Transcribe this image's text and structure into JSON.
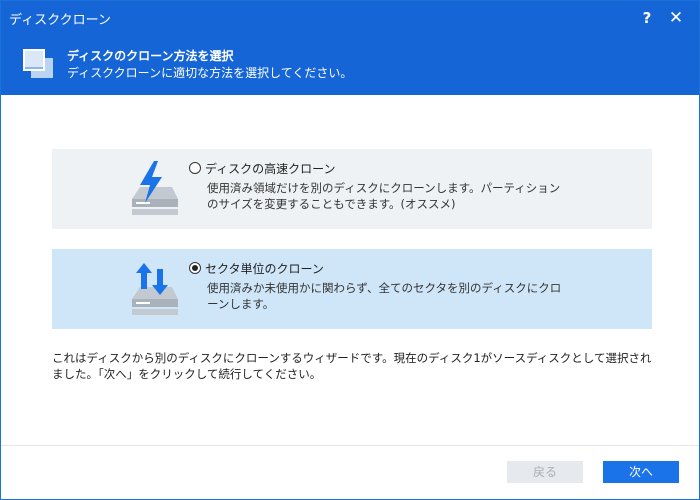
{
  "window": {
    "title": "ディスククローン"
  },
  "controls": {
    "help": "?",
    "close": "✕"
  },
  "header": {
    "title": "ディスクのクローン方法を選択",
    "subtitle": "ディスククローンに適切な方法を選択してください。"
  },
  "options": [
    {
      "title": "ディスクの高速クローン",
      "description": "使用済み領域だけを別のディスクにクローンします。パーティションのサイズを変更することもできます。(オススメ)",
      "selected": false
    },
    {
      "title": "セクタ単位のクローン",
      "description": "使用済みか未使用かに関わらず、全てのセクタを別のディスクにクローンします。",
      "selected": true
    }
  ],
  "info_text": "これはディスクから別のディスクにクローンするウィザードです。現在のディスク1がソースディスクとして選択されました。「次へ」をクリックして続行してください。",
  "buttons": {
    "back": "戻る",
    "next": "次へ"
  },
  "colors": {
    "accent": "#1565d6",
    "selected_option_bg": "#cfe6f8",
    "option_bg": "#eff2f5",
    "icon_blue": "#1a73e8"
  }
}
